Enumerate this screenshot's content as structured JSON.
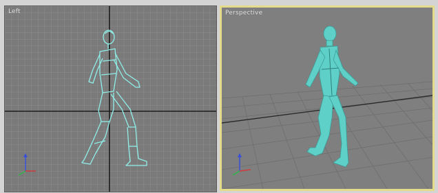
{
  "viewports": {
    "left": {
      "label": "Left",
      "active": false
    },
    "perspective": {
      "label": "Perspective",
      "active": true
    }
  },
  "colors": {
    "viewport_bg": "#7b7b7b",
    "grid_minor": "#8c8c8c",
    "grid_major": "#1a1a1a",
    "active_border": "#e4dc8a",
    "wireframe": "#8ff0ea",
    "shaded_model": "#5fd0c8",
    "axis_x": "#d23a3a",
    "axis_y": "#2fb84a",
    "axis_z": "#3a4fd8"
  },
  "icons": [
    "axis-tripod-icon"
  ]
}
